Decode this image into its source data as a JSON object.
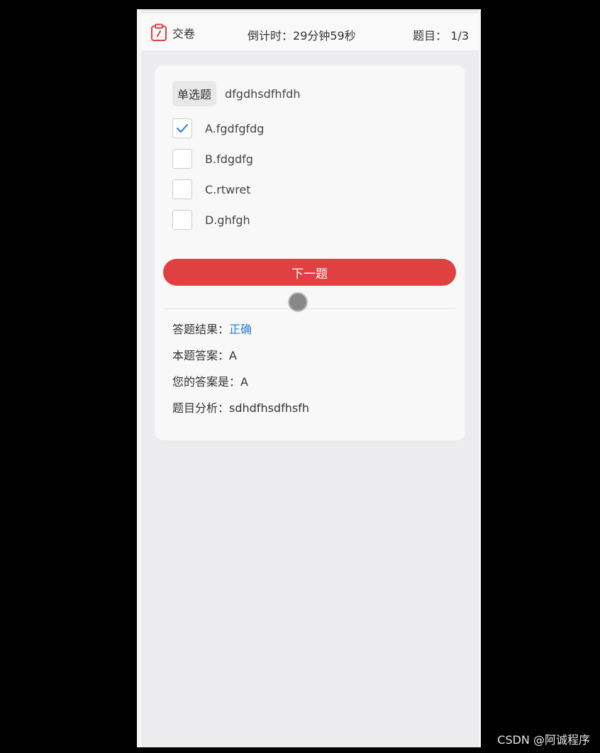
{
  "header": {
    "submit_label": "交卷",
    "countdown_label": "倒计时：",
    "countdown_value": "29分钟59秒",
    "question_counter_label": "题目：",
    "question_counter_value": "1/3",
    "submit_icon": "clipboard-icon",
    "accent_color": "#E04040"
  },
  "question": {
    "type_label": "单选题",
    "stem": "dfgdhsdfhfdh",
    "options": [
      {
        "label": "A.fgdfgfdg",
        "checked": true
      },
      {
        "label": "B.fdgdfg",
        "checked": false
      },
      {
        "label": "C.rtwret",
        "checked": false
      },
      {
        "label": "D.ghfgh",
        "checked": false
      }
    ]
  },
  "actions": {
    "next_label": "下一题",
    "next_color": "#E04040"
  },
  "result": {
    "result_label": "答题结果：",
    "result_value": "正确",
    "result_color": "#2D7CD4",
    "answer_label": "本题答案：",
    "answer_value": "A",
    "your_answer_label": "您的答案是：",
    "your_answer_value": "A",
    "analysis_label": "题目分析：",
    "analysis_value": "sdhdfhsdfhsfh"
  },
  "watermark": "CSDN @阿诚程序"
}
